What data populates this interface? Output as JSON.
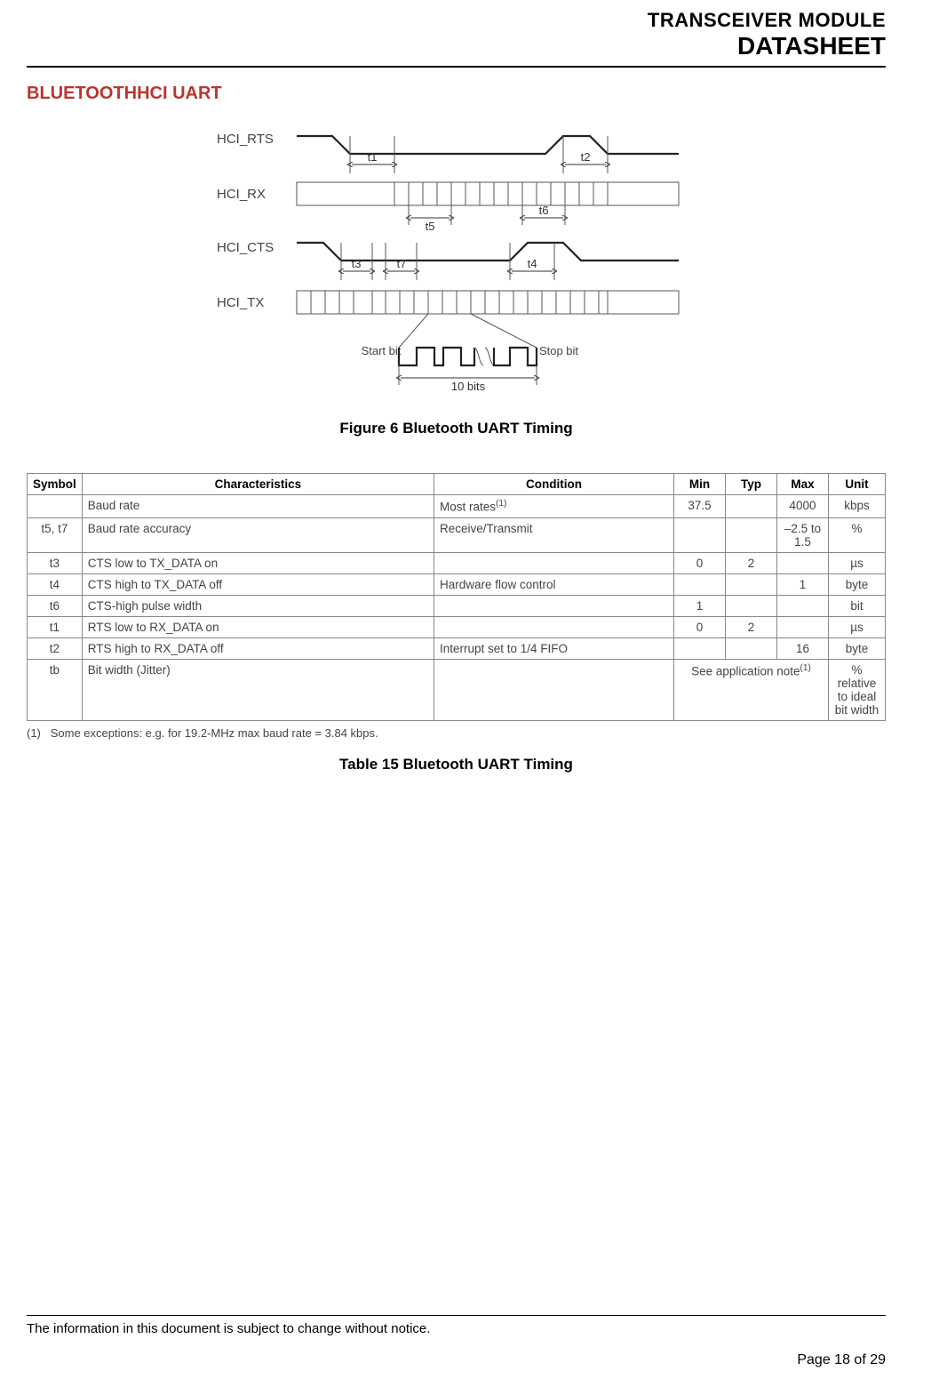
{
  "header": {
    "line1": "TRANSCEIVER MODULE",
    "line2": "DATASHEET"
  },
  "section_title": "BLUETOOTHHCI UART",
  "diagram": {
    "signals": [
      "HCI_RTS",
      "HCI_RX",
      "HCI_CTS",
      "HCI_TX"
    ],
    "markers": [
      "t1",
      "t2",
      "t3",
      "t4",
      "t5",
      "t6",
      "t7"
    ],
    "start_bit": "Start bit",
    "stop_bit": "Stop bit",
    "ten_bits": "10 bits"
  },
  "figure_caption": "Figure 6 Bluetooth UART Timing",
  "table": {
    "headers": [
      "Symbol",
      "Characteristics",
      "Condition",
      "Min",
      "Typ",
      "Max",
      "Unit"
    ],
    "rows": [
      {
        "symbol": "",
        "char": "Baud rate",
        "cond": "Most rates",
        "cond_sup": "(1)",
        "min": "37.5",
        "typ": "",
        "max": "4000",
        "unit": "kbps"
      },
      {
        "symbol": "t5, t7",
        "char": "Baud rate accuracy",
        "cond": "Receive/Transmit",
        "cond_sup": "",
        "min": "",
        "typ": "",
        "max": "–2.5 to 1.5",
        "unit": "%"
      },
      {
        "symbol": "t3",
        "char": "CTS low to TX_DATA on",
        "cond": "",
        "cond_sup": "",
        "min": "0",
        "typ": "2",
        "max": "",
        "unit": "µs"
      },
      {
        "symbol": "t4",
        "char": "CTS high to TX_DATA off",
        "cond": "Hardware flow control",
        "cond_sup": "",
        "min": "",
        "typ": "",
        "max": "1",
        "unit": "byte"
      },
      {
        "symbol": "t6",
        "char": "CTS-high pulse width",
        "cond": "",
        "cond_sup": "",
        "min": "1",
        "typ": "",
        "max": "",
        "unit": "bit"
      },
      {
        "symbol": "t1",
        "char": "RTS low to RX_DATA on",
        "cond": "",
        "cond_sup": "",
        "min": "0",
        "typ": "2",
        "max": "",
        "unit": "µs"
      },
      {
        "symbol": "t2",
        "char": "RTS high to RX_DATA off",
        "cond": "Interrupt set to 1/4 FIFO",
        "cond_sup": "",
        "min": "",
        "typ": "",
        "max": "16",
        "unit": "byte"
      },
      {
        "symbol": "tb",
        "char": "Bit width (Jitter)",
        "cond": "",
        "cond_sup": "",
        "min_colspan": "See application note",
        "min_sup": "(1)",
        "unit": "% relative to ideal bit width"
      }
    ],
    "footnote_marker": "(1)",
    "footnote_text": "Some exceptions: e.g. for 19.2-MHz max baud rate = 3.84 kbps."
  },
  "table_caption": "Table 15 Bluetooth UART Timing",
  "footer": {
    "notice": "The information in this document is subject to change without notice.",
    "page": "Page 18 of 29"
  },
  "chart_data": {
    "type": "table",
    "title": "Bluetooth UART Timing",
    "columns": [
      "Symbol",
      "Characteristics",
      "Condition",
      "Min",
      "Typ",
      "Max",
      "Unit"
    ],
    "rows": [
      [
        "",
        "Baud rate",
        "Most rates (1)",
        37.5,
        null,
        4000,
        "kbps"
      ],
      [
        "t5, t7",
        "Baud rate accuracy",
        "Receive/Transmit",
        null,
        null,
        "-2.5 to 1.5",
        "%"
      ],
      [
        "t3",
        "CTS low to TX_DATA on",
        "",
        0,
        2,
        null,
        "µs"
      ],
      [
        "t4",
        "CTS high to TX_DATA off",
        "Hardware flow control",
        null,
        null,
        1,
        "byte"
      ],
      [
        "t6",
        "CTS-high pulse width",
        "",
        1,
        null,
        null,
        "bit"
      ],
      [
        "t1",
        "RTS low to RX_DATA on",
        "",
        0,
        2,
        null,
        "µs"
      ],
      [
        "t2",
        "RTS high to RX_DATA off",
        "Interrupt set to 1/4 FIFO",
        null,
        null,
        16,
        "byte"
      ],
      [
        "tb",
        "Bit width (Jitter)",
        "",
        "See application note (1)",
        null,
        null,
        "% relative to ideal bit width"
      ]
    ]
  }
}
